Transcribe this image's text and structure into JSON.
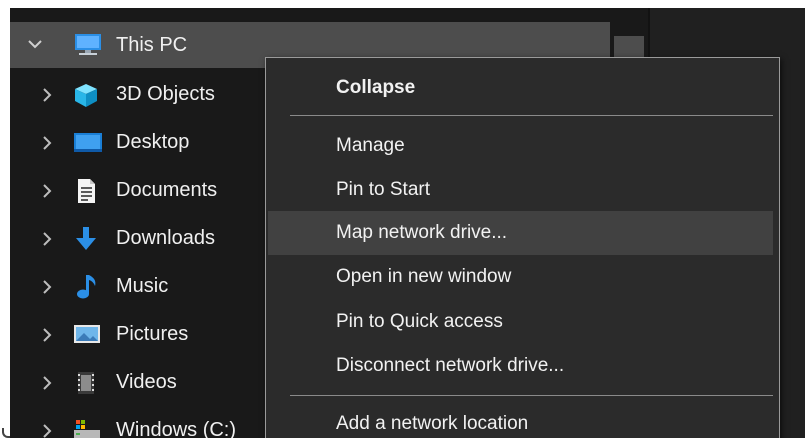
{
  "tree": {
    "root": {
      "label": "This PC",
      "icon": "computer-icon",
      "expanded": true
    },
    "items": [
      {
        "label": "3D Objects",
        "icon": "3d-objects-icon"
      },
      {
        "label": "Desktop",
        "icon": "desktop-icon"
      },
      {
        "label": "Documents",
        "icon": "documents-icon"
      },
      {
        "label": "Downloads",
        "icon": "downloads-icon"
      },
      {
        "label": "Music",
        "icon": "music-icon"
      },
      {
        "label": "Pictures",
        "icon": "pictures-icon"
      },
      {
        "label": "Videos",
        "icon": "videos-icon"
      },
      {
        "label": "Windows (C:)",
        "icon": "drive-icon"
      }
    ]
  },
  "context_menu": {
    "items": [
      {
        "label": "Collapse",
        "bold": true
      },
      {
        "label": "Manage"
      },
      {
        "label": "Pin to Start"
      },
      {
        "label": "Map network drive...",
        "hovered": true
      },
      {
        "label": "Open in new window"
      },
      {
        "label": "Pin to Quick access"
      },
      {
        "label": "Disconnect network drive..."
      },
      {
        "label": "Add a network location"
      }
    ]
  },
  "colors": {
    "nav_background": "#191919",
    "selected_row": "#4d4d4d",
    "menu_background": "#2b2b2b",
    "menu_hover": "#414141",
    "text": "#f0f0f0",
    "accent_blue": "#2b8fe6"
  }
}
